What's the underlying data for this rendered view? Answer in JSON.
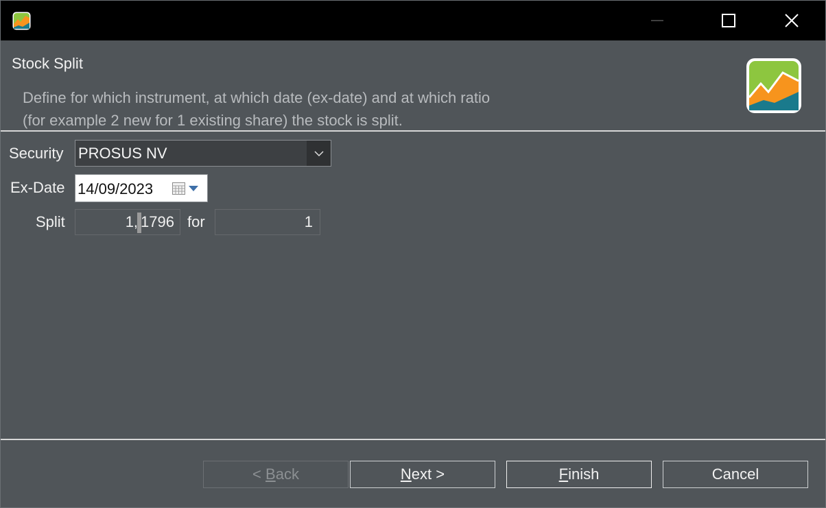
{
  "window": {
    "controls": {
      "minimize": "minimize",
      "maximize": "maximize",
      "close": "close"
    }
  },
  "header": {
    "title": "Stock Split",
    "description": "Define for which instrument, at which date (ex-date) and at which ratio\n(for example 2 new for 1 existing share) the stock is split."
  },
  "form": {
    "security_label": "Security",
    "security_value": "PROSUS NV",
    "exdate_label": "Ex-Date",
    "exdate_value": "14/09/2023",
    "split_label": "Split",
    "split_value_before_caret": "1,",
    "split_value_after_caret": "1796",
    "for_label": "for",
    "for_value": "1"
  },
  "buttons": {
    "back_prefix": "< ",
    "back_mnemonic": "B",
    "back_rest": "ack",
    "next_mnemonic": "N",
    "next_rest": "ext >",
    "finish_mnemonic": "F",
    "finish_rest": "inish",
    "cancel": "Cancel"
  },
  "colors": {
    "background": "#505559",
    "titlebar": "#000000",
    "logo_green": "#8dc63f",
    "logo_orange": "#f7941d",
    "logo_teal": "#1a7a8c"
  }
}
